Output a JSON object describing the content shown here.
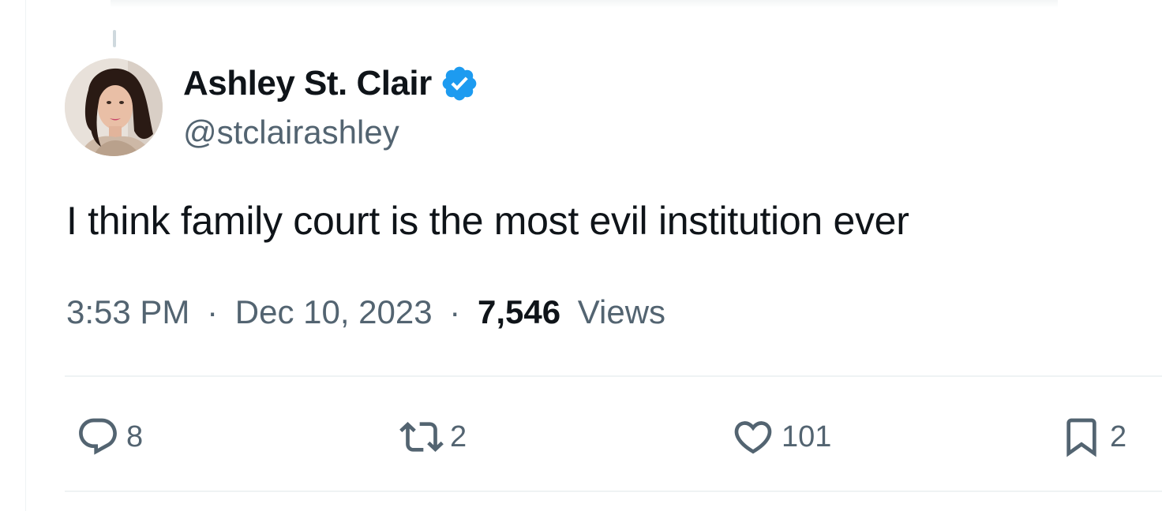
{
  "author": {
    "display_name": "Ashley St. Clair",
    "handle": "@stclairashley",
    "verified": true,
    "verified_color": "#1d9bf0",
    "avatar_icon": "profile-photo"
  },
  "tweet": {
    "text": "I think family court is the most evil institution ever"
  },
  "meta": {
    "time": "3:53 PM",
    "separator": "·",
    "date": "Dec 10, 2023",
    "views_count": "7,546",
    "views_label": "Views"
  },
  "actions": {
    "replies": {
      "icon": "reply-icon",
      "count": "8"
    },
    "retweets": {
      "icon": "retweet-icon",
      "count": "2"
    },
    "likes": {
      "icon": "heart-icon",
      "count": "101"
    },
    "bookmarks": {
      "icon": "bookmark-icon",
      "count": "2"
    }
  },
  "colors": {
    "text_primary": "#0f1419",
    "text_secondary": "#536471",
    "divider": "#eff3f4",
    "accent": "#1d9bf0"
  }
}
